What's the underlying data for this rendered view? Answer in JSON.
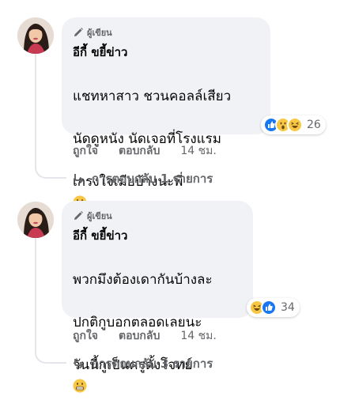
{
  "comments": [
    {
      "badge": "ผู้เขียน",
      "author": "อีกี้ ขยี้ข่าว",
      "lines": [
        "แชทหาสาว ชวนคอลล์เสียว",
        "นัดดูหนัง นัดเจอที่โรงแรม",
        "เกรงใจเมียบ้างนะพี่"
      ],
      "inline_emoji": "grimacing-face",
      "reactions": [
        "like",
        "wow",
        "haha"
      ],
      "reaction_count": "26",
      "like_label": "ถูกใจ",
      "reply_label": "ตอบกลับ",
      "time": "14 ชม.",
      "replies_label": "การตอบกลับ 1 รายการ"
    },
    {
      "badge": "ผู้เขียน",
      "author": "อีกี้ ขยี้ข่าว",
      "lines": [
        "พวกมึงต้องเดากันบ้างละ",
        "ปกติกูบอกตลอดเลยนะ",
        "วันนี้กูเป็นครูตั้งโจทย์"
      ],
      "inline_emoji": "grimacing-face",
      "reactions": [
        "haha",
        "like"
      ],
      "reaction_count": "34",
      "like_label": "ถูกใจ",
      "reply_label": "ตอบกลับ",
      "time": "14 ชม.",
      "replies_label": "การตอบกลับ 3 รายการ"
    }
  ],
  "colors": {
    "like": "#1877f2",
    "emoji": "#f7c845",
    "muted": "#65676b",
    "bubble": "#f0f2f5"
  }
}
